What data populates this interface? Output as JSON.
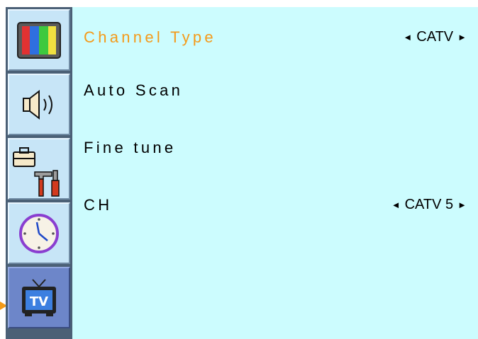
{
  "sidebar": {
    "tabs": [
      {
        "name": "picture",
        "icon": "color-bars-icon",
        "active": false
      },
      {
        "name": "sound",
        "icon": "speaker-icon",
        "active": false
      },
      {
        "name": "setup",
        "icon": "toolbox-icon",
        "active": false
      },
      {
        "name": "time",
        "icon": "clock-icon",
        "active": false
      },
      {
        "name": "tv",
        "icon": "tv-icon",
        "active": true
      }
    ]
  },
  "menu": {
    "items": [
      {
        "label": "Channel Type",
        "value": "CATV",
        "active": true
      },
      {
        "label": "Auto Scan"
      },
      {
        "label": "Fine tune"
      },
      {
        "label": "CH",
        "value": "CATV 5"
      }
    ],
    "arrow_left": "◄",
    "arrow_right": "►"
  },
  "colors": {
    "panel_bg": "#ccfcfe",
    "active_text": "#f49a1a",
    "sidebar_bg": "#4b6076",
    "tab_bg": "#c7e5f7",
    "active_tab_bg": "#6d86c9",
    "selector_arrow": "#f39a17"
  }
}
